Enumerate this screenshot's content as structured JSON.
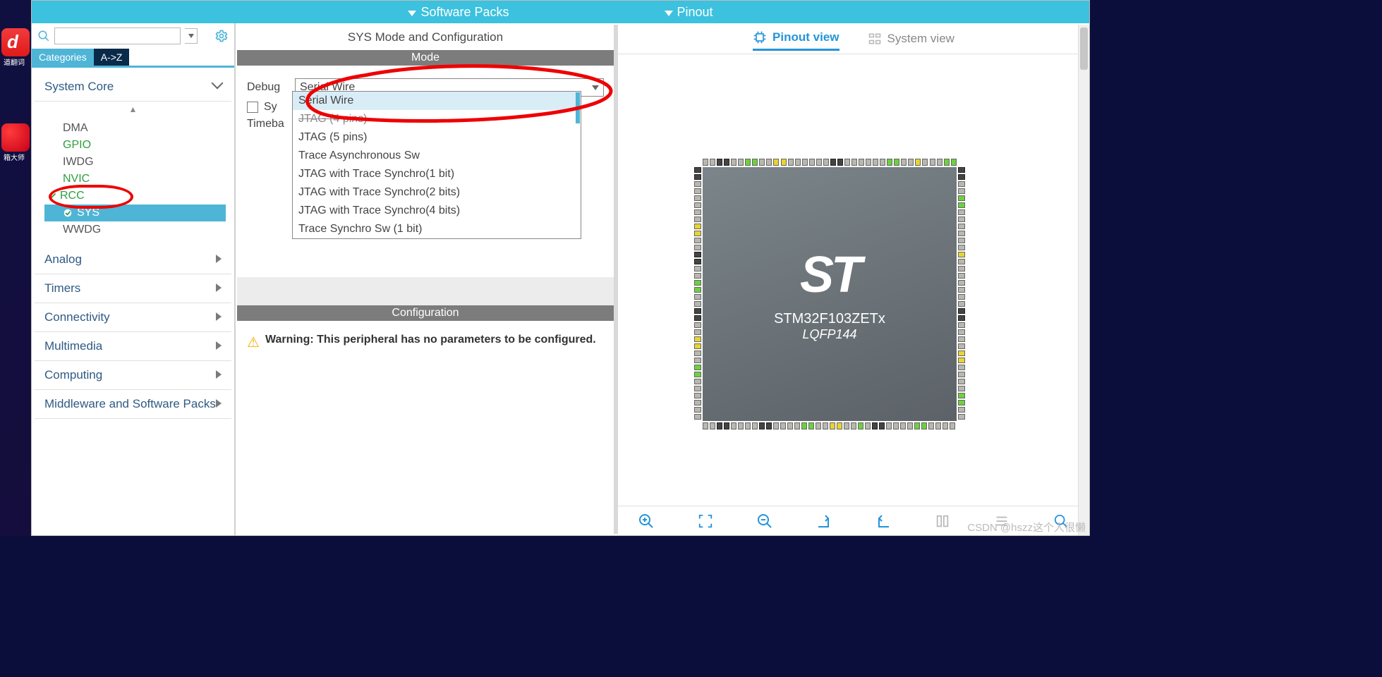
{
  "desktop": {
    "app1_label": "道翻词",
    "app2_label": "箱大师"
  },
  "topbar": {
    "menus": [
      "Software Packs",
      "Pinout"
    ]
  },
  "search": {
    "placeholder": ""
  },
  "tabs": {
    "categories": "Categories",
    "az": "A->Z"
  },
  "categories": {
    "system_core": {
      "label": "System Core",
      "items": [
        "DMA",
        "GPIO",
        "IWDG",
        "NVIC",
        "RCC",
        "SYS",
        "WWDG"
      ],
      "green_items": [
        "GPIO",
        "NVIC",
        "RCC",
        "SYS"
      ],
      "selected": "SYS"
    },
    "others": [
      "Analog",
      "Timers",
      "Connectivity",
      "Multimedia",
      "Computing",
      "Middleware and Software Packs"
    ]
  },
  "mid": {
    "title": "SYS Mode and Configuration",
    "mode_bar": "Mode",
    "debug_label": "Debug",
    "debug_value": "Serial Wire",
    "syswake_label": "System Wake-Up",
    "timebase_label": "Timebase Source",
    "debug_options": [
      "Serial Wire",
      "JTAG (4 pins)",
      "JTAG (5 pins)",
      "Trace Asynchronous Sw",
      "JTAG with Trace Synchro(1 bit)",
      "JTAG with Trace Synchro(2 bits)",
      "JTAG with Trace Synchro(4 bits)",
      "Trace Synchro Sw (1 bit)"
    ],
    "config_bar": "Configuration",
    "warning": "Warning: This peripheral has no parameters to be configured."
  },
  "right": {
    "tabs": {
      "pinout": "Pinout view",
      "system": "System view"
    },
    "chip": {
      "name": "STM32F103ZETx",
      "package": "LQFP144"
    }
  },
  "watermark": "CSDN @hszz这个人很懒"
}
